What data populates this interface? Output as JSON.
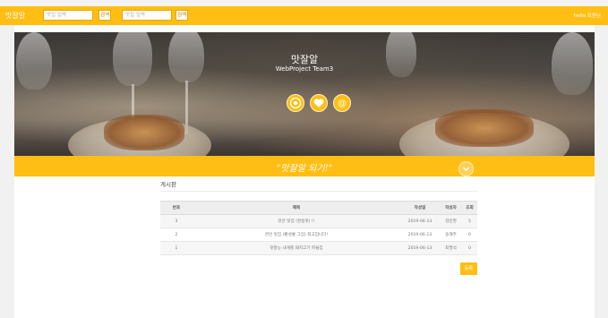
{
  "nav": {
    "brand": "맛잘알",
    "search1": {
      "placeholder": "맛집 입력",
      "button": "검색"
    },
    "search2": {
      "placeholder": "맛집 입력",
      "button": "검색"
    },
    "right_text": "hello 회원님"
  },
  "hero": {
    "title": "맛잘알",
    "subtitle": "WebProject Team3",
    "icons": [
      "target-icon",
      "heart-icon",
      "at-icon"
    ]
  },
  "slogan": "\"맛잘알 되기!\"",
  "board": {
    "title": "게시판",
    "columns": [
      "번호",
      "제목",
      "작성일",
      "작성자",
      "조회"
    ],
    "rows": [
      {
        "no": "3",
        "title": "천안 맛집 (천동맛) !!",
        "date": "2019-06-13",
        "author": "김민영",
        "views": "5"
      },
      {
        "no": "2",
        "title": "천안 맛집 (황성룡 그집) 최고입니다!",
        "date": "2019-06-13",
        "author": "송해주",
        "views": "0"
      },
      {
        "no": "1",
        "title": "맛잘능 내게를 돼지고기 파을집",
        "date": "2019-06-13",
        "author": "최필석",
        "views": "0"
      }
    ],
    "write_button": "등록"
  },
  "colors": {
    "accent": "#ffbe13",
    "background": "#f3f3f3",
    "panel": "#ffffff"
  }
}
